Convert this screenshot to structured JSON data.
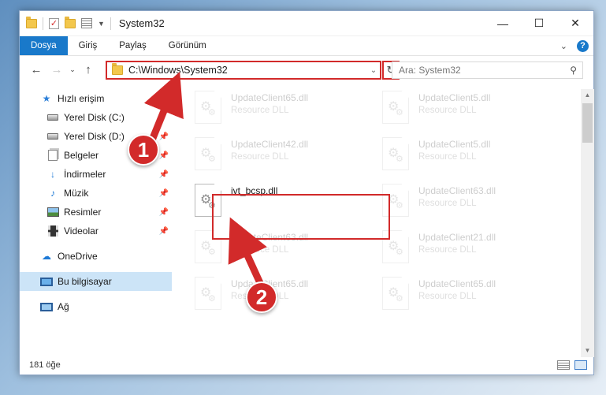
{
  "window": {
    "title": "System32",
    "controls": {
      "minimize": "—",
      "maximize": "☐",
      "close": "✕"
    }
  },
  "ribbon": {
    "tabs": [
      "Dosya",
      "Giriş",
      "Paylaş",
      "Görünüm"
    ],
    "help": "?"
  },
  "navigation": {
    "back": "←",
    "forward": "→",
    "recent": "⌄",
    "up": "↑",
    "address": "C:\\Windows\\System32",
    "search_placeholder": "Ara: System32"
  },
  "sidebar": {
    "items": [
      {
        "label": "Hızlı erişim",
        "icon": "star-icon"
      },
      {
        "label": "Yerel Disk (C:)",
        "icon": "drive-icon",
        "pinned": false
      },
      {
        "label": "Yerel Disk (D:)",
        "icon": "drive-icon",
        "pinned": true
      },
      {
        "label": "Belgeler",
        "icon": "documents-icon",
        "pinned": true
      },
      {
        "label": "İndirmeler",
        "icon": "download-icon",
        "pinned": true
      },
      {
        "label": "Müzik",
        "icon": "music-icon",
        "pinned": true
      },
      {
        "label": "Resimler",
        "icon": "pictures-icon",
        "pinned": true
      },
      {
        "label": "Videolar",
        "icon": "videos-icon",
        "pinned": true
      },
      {
        "label": "OneDrive",
        "icon": "onedrive-icon"
      },
      {
        "label": "Bu bilgisayar",
        "icon": "computer-icon",
        "selected": true
      },
      {
        "label": "Ağ",
        "icon": "network-icon"
      }
    ]
  },
  "files": {
    "type_label": "Resource DLL",
    "items": [
      {
        "name": "UpdateClient65.dll",
        "faded": true
      },
      {
        "name": "UpdateClient5.dll",
        "faded": true
      },
      {
        "name": "UpdateClient42.dll",
        "faded": true
      },
      {
        "name": "UpdateClient5.dll",
        "faded": true
      },
      {
        "name": "ivt_bcsp.dll",
        "faded": false
      },
      {
        "name": "UpdateClient63.dll",
        "faded": true
      },
      {
        "name": "UpdateClient63.dll",
        "faded": true
      },
      {
        "name": "UpdateClient21.dll",
        "faded": true
      },
      {
        "name": "UpdateClient65.dll",
        "faded": true
      },
      {
        "name": "UpdateClient65.dll",
        "faded": true
      }
    ]
  },
  "status": {
    "item_count": "181 öğe"
  },
  "annotations": {
    "step1": "1",
    "step2": "2",
    "accent_color": "#d22a2a"
  }
}
